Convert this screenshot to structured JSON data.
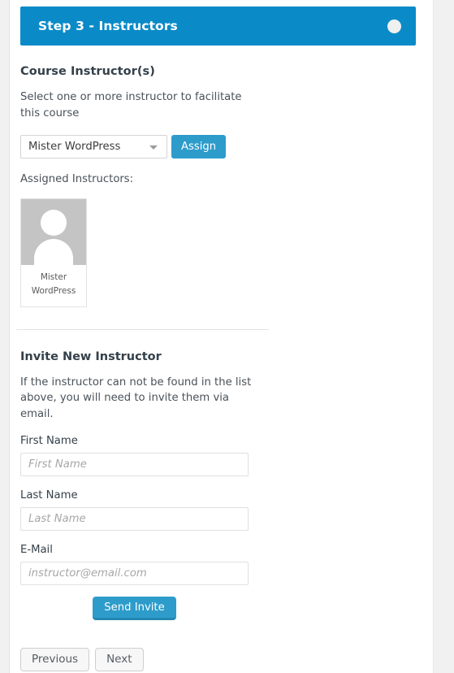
{
  "header": {
    "title": "Step 3 - Instructors",
    "indicator_icon": "circle-indicator-icon",
    "background_color": "#0a8bc8"
  },
  "course_instructors": {
    "section_title": "Course Instructor(s)",
    "description": "Select one or more instructor to facilitate this course",
    "instructor_select": {
      "selected": "Mister WordPress",
      "caret_icon": "chevron-down-icon"
    },
    "assign_button": "Assign",
    "assigned_label": "Assigned Instructors:",
    "assigned": [
      {
        "name_line_1": "Mister",
        "name_line_2": "WordPress",
        "avatar_icon": "user-placeholder-icon"
      }
    ]
  },
  "invite": {
    "title": "Invite New Instructor",
    "description": "If the instructor can not be found in the list above, you will need to invite them via email.",
    "fields": [
      {
        "label": "First Name",
        "value": "",
        "placeholder": "First Name"
      },
      {
        "label": "Last Name",
        "value": "",
        "placeholder": "Last Name"
      },
      {
        "label": "E-Mail",
        "value": "",
        "placeholder": "instructor@email.com"
      }
    ],
    "send_button": "Send Invite"
  },
  "navigation": {
    "previous": "Previous",
    "next": "Next"
  },
  "colors": {
    "accent_blue": "#0a8bc8",
    "button_blue": "#2d9ccb",
    "button_blue_shadow": "#2387b1",
    "text_dark": "#34404a",
    "text_body": "#4a5259",
    "page_background": "#f1f1f1"
  }
}
